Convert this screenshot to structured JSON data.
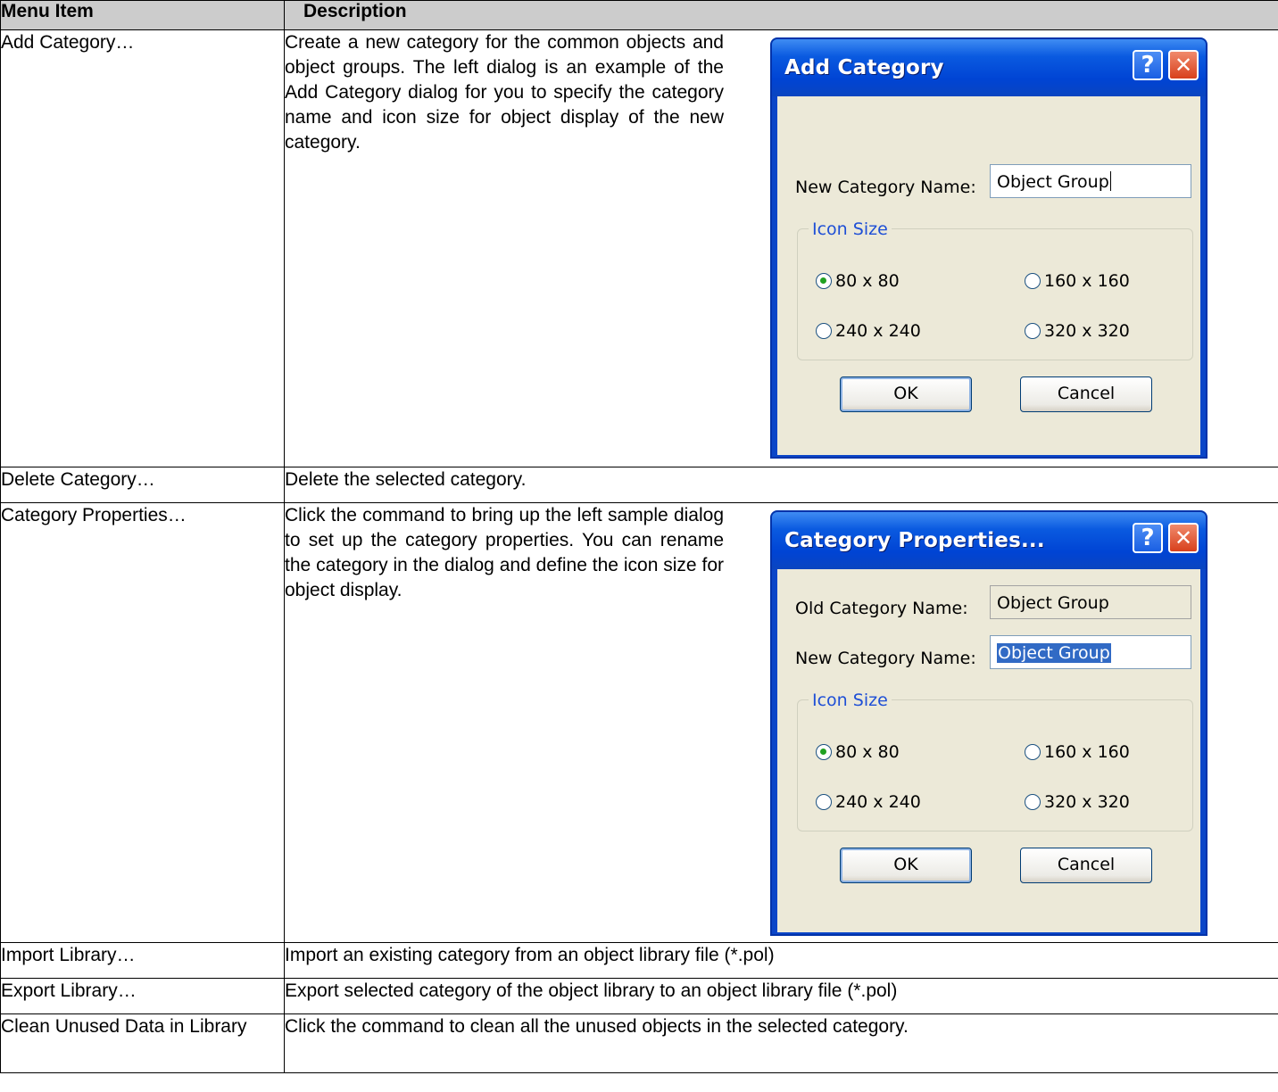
{
  "table": {
    "headers": {
      "menu_item": "Menu Item",
      "description": "Description"
    },
    "rows": [
      {
        "item": "Add Category…",
        "description": "Create a new category for the common objects and object groups. The left dialog is an example of the Add Category dialog for you to specify the category name and icon size for object display of the new category."
      },
      {
        "item": "Delete Category…",
        "description": "Delete the selected category."
      },
      {
        "item": "Category Properties…",
        "description": "Click the command to bring up the left sample dialog to set up the category properties. You can rename the category in the dialog and define the icon size for object display."
      },
      {
        "item": "Import Library…",
        "description": "Import an existing category from an object library file (*.pol)"
      },
      {
        "item": "Export Library…",
        "description": "Export selected category of the object library to an object library file (*.pol)"
      },
      {
        "item": "Clean Unused Data in Library",
        "description": "Click the command to clean all the unused objects in the selected category."
      }
    ]
  },
  "dialog_add": {
    "title": "Add Category",
    "help_glyph": "?",
    "close_glyph": "✕",
    "new_name_label": "New Category Name:",
    "new_name_value": "Object Group",
    "group_title": "Icon Size",
    "options": [
      "80 x 80",
      "160 x 160",
      "240 x 240",
      "320 x 320"
    ],
    "selected_option": "80 x 80",
    "ok": "OK",
    "cancel": "Cancel"
  },
  "dialog_props": {
    "title": "Category Properties...",
    "help_glyph": "?",
    "close_glyph": "✕",
    "old_name_label": "Old Category Name:",
    "old_name_value": "Object Group",
    "new_name_label": "New Category Name:",
    "new_name_value": "Object Group",
    "group_title": "Icon Size",
    "options": [
      "80 x 80",
      "160 x 160",
      "240 x 240",
      "320 x 320"
    ],
    "selected_option": "80 x 80",
    "ok": "OK",
    "cancel": "Cancel"
  },
  "colors": {
    "header_bg": "#cccccc",
    "dialog_title_bar": "#0a5ae0",
    "dialog_body": "#ece9d8",
    "selection": "#316ac5"
  }
}
